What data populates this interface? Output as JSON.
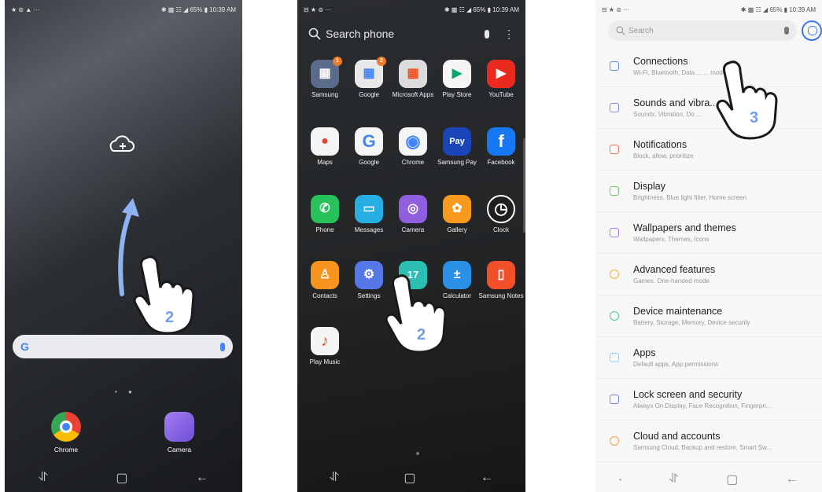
{
  "status": {
    "left_icons": "★ ⊜ ▲ ···",
    "drawer_left": "⊟ ★ ⊜ ···",
    "right": "✱ ▩ ☷ ◢ 65% ▮ 10:39 AM"
  },
  "home": {
    "step": "2",
    "google_letter": "G",
    "dock": [
      {
        "label": "Chrome"
      },
      {
        "label": "Camera"
      }
    ]
  },
  "drawer": {
    "search_placeholder": "Search phone",
    "step": "2",
    "apps": [
      {
        "label": "Samsung",
        "badge": "1",
        "color": "#5b6b8c",
        "glyph": "▦"
      },
      {
        "label": "Google",
        "badge": "2",
        "color": "#e8e8e8",
        "glyph": "▦"
      },
      {
        "label": "Microsoft Apps",
        "badge": "",
        "color": "#dcdcdc",
        "glyph": "▦"
      },
      {
        "label": "Play Store",
        "badge": "",
        "color": "#f5f5f5",
        "glyph": "▶"
      },
      {
        "label": "YouTube",
        "badge": "",
        "color": "#ea2a1f",
        "glyph": "▶"
      },
      {
        "label": "Maps",
        "badge": "",
        "color": "#f5f5f5",
        "glyph": "●"
      },
      {
        "label": "Google",
        "badge": "",
        "color": "#f5f5f5",
        "glyph": "G"
      },
      {
        "label": "Chrome",
        "badge": "",
        "color": "#f5f5f5",
        "glyph": "◉"
      },
      {
        "label": "Samsung Pay",
        "badge": "",
        "color": "#1b44b8",
        "glyph": "Pay"
      },
      {
        "label": "Facebook",
        "badge": "",
        "color": "#1877f2",
        "glyph": "f"
      },
      {
        "label": "Phone",
        "badge": "",
        "color": "#28c25a",
        "glyph": "✆"
      },
      {
        "label": "Messages",
        "badge": "",
        "color": "#27aee5",
        "glyph": "▭"
      },
      {
        "label": "Camera",
        "badge": "",
        "color": "#8f5fe0",
        "glyph": "◎"
      },
      {
        "label": "Gallery",
        "badge": "",
        "color": "#f79a1e",
        "glyph": "✿"
      },
      {
        "label": "Clock",
        "badge": "",
        "color": "#1f1f1f",
        "glyph": "◷"
      },
      {
        "label": "Contacts",
        "badge": "",
        "color": "#f7941e",
        "glyph": "♙"
      },
      {
        "label": "Settings",
        "badge": "",
        "color": "#5577e8",
        "glyph": "⚙"
      },
      {
        "label": "",
        "badge": "",
        "color": "#2bbfb3",
        "glyph": "17"
      },
      {
        "label": "Calculator",
        "badge": "",
        "color": "#2a8fe6",
        "glyph": "±"
      },
      {
        "label": "Samsung Notes",
        "badge": "",
        "color": "#f2502b",
        "glyph": "▯"
      },
      {
        "label": "Play Music",
        "badge": "",
        "color": "#f5f5f5",
        "glyph": "♪"
      }
    ]
  },
  "settings": {
    "search_placeholder": "Search",
    "step": "3",
    "items": [
      {
        "title": "Connections",
        "subtitle": "Wi-Fi, Bluetooth, Data ... ... mode",
        "color": "#5a8fe0"
      },
      {
        "title": "Sounds and vibra...",
        "subtitle": "Sounds, Vibration, Do ...",
        "color": "#7a8fe8"
      },
      {
        "title": "Notifications",
        "subtitle": "Block, allow, prioritize",
        "color": "#f0706a"
      },
      {
        "title": "Display",
        "subtitle": "Brightness, Blue light filter, Home screen",
        "color": "#7cc46d"
      },
      {
        "title": "Wallpapers and themes",
        "subtitle": "Wallpapers, Themes, Icons",
        "color": "#a878e6"
      },
      {
        "title": "Advanced features",
        "subtitle": "Games, One-handed mode",
        "color": "#f4b33a"
      },
      {
        "title": "Device maintenance",
        "subtitle": "Battery, Storage, Memory, Device security",
        "color": "#4fc6a8"
      },
      {
        "title": "Apps",
        "subtitle": "Default apps, App permissions",
        "color": "#5aa6e8"
      },
      {
        "title": "Lock screen and security",
        "subtitle": "Always On Display, Face Recognition, Fingerpri...",
        "color": "#7a7fe6"
      },
      {
        "title": "Cloud and accounts",
        "subtitle": "Samsung Cloud, Backup and restore, Smart Sw...",
        "color": "#f4a531"
      }
    ]
  },
  "nav": {
    "recent": "⥯",
    "home": "▢",
    "back": "←"
  }
}
